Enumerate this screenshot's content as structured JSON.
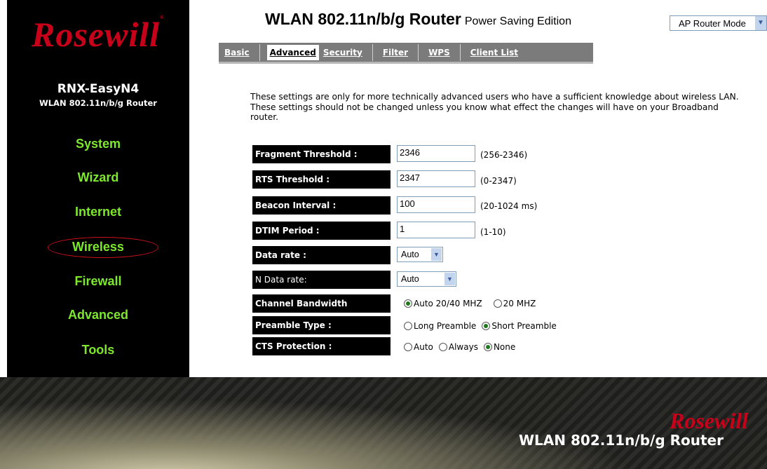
{
  "sidebar": {
    "logo": "Rosewill",
    "model": "RNX-EasyN4",
    "model_sub": "WLAN 802.11n/b/g Router",
    "items": [
      {
        "label": "System"
      },
      {
        "label": "Wizard"
      },
      {
        "label": "Internet"
      },
      {
        "label": "Wireless"
      },
      {
        "label": "Firewall"
      },
      {
        "label": "Advanced"
      },
      {
        "label": "Tools"
      }
    ]
  },
  "header": {
    "title": "WLAN 802.11n/b/g Router",
    "edition": "Power Saving Edition",
    "mode": "AP Router Mode"
  },
  "tabs": [
    "Basic",
    "Advanced",
    "Security",
    "Filter",
    "WPS",
    "Client List"
  ],
  "intro": "These settings are only for more technically advanced users who have a sufficient knowledge about wireless LAN. These settings should not be changed unless you know what effect the changes will have on your Broadband router.",
  "form": {
    "fragment": {
      "label": "Fragment Threshold :",
      "value": "2346",
      "range": "(256-2346)"
    },
    "rts": {
      "label": "RTS Threshold :",
      "value": "2347",
      "range": "(0-2347)"
    },
    "beacon": {
      "label": "Beacon Interval :",
      "value": "100",
      "range": "(20-1024 ms)"
    },
    "dtim": {
      "label": "DTIM Period :",
      "value": "1",
      "range": "(1-10)"
    },
    "data_rate": {
      "label": "Data rate :",
      "value": "Auto"
    },
    "n_data_rate": {
      "label": "N Data rate:",
      "value": "Auto"
    },
    "bandwidth": {
      "label": "Channel Bandwidth",
      "options": [
        "Auto 20/40 MHZ",
        "20 MHZ"
      ],
      "selected": "Auto 20/40 MHZ"
    },
    "preamble": {
      "label": "Preamble Type :",
      "options": [
        "Long Preamble",
        "Short Preamble"
      ],
      "selected": "Short Preamble"
    },
    "cts": {
      "label": "CTS Protection :",
      "options": [
        "Auto",
        "Always",
        "None"
      ],
      "selected": "None"
    }
  },
  "footer": {
    "logo": "Rosewill",
    "title": "WLAN 802.11n/b/g Router"
  },
  "colors": {
    "nav_green": "#7de82c",
    "brand_red": "#c8001a",
    "tab_bar": "#7b7b7b"
  }
}
